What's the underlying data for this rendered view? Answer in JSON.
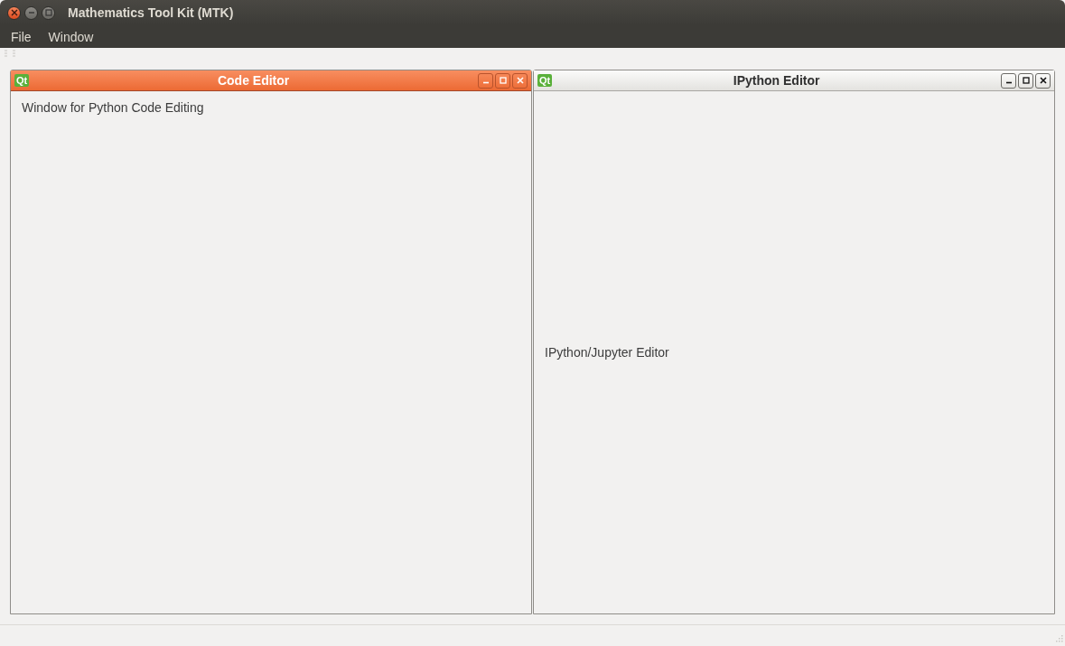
{
  "window": {
    "title": "Mathematics Tool Kit (MTK)"
  },
  "menu": [
    "File",
    "Window"
  ],
  "subwindows": [
    {
      "title": "Code Editor",
      "selected": true,
      "icon": "Qt",
      "label": "Window for Python Code Editing",
      "kind": "top"
    },
    {
      "title": "IPython Editor",
      "selected": false,
      "icon": "Qt",
      "label": "IPython/Jupyter Editor",
      "kind": "middle"
    }
  ]
}
